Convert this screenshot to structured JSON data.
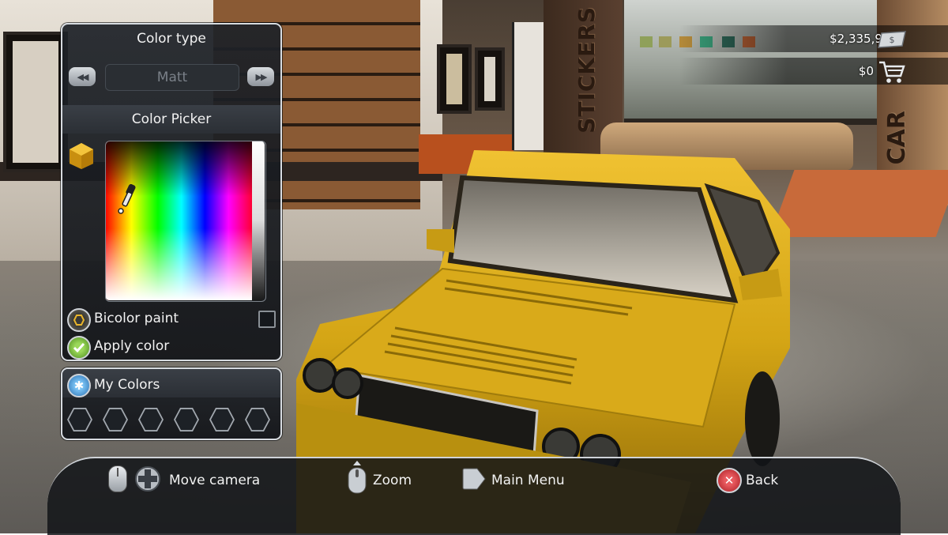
{
  "color_panel": {
    "title": "Color type",
    "selected_type": "Matt",
    "picker_title": "Color Picker",
    "bicolor_label": "Bicolor paint",
    "bicolor_checked": false,
    "apply_label": "Apply color"
  },
  "my_colors": {
    "title": "My Colors",
    "slots": [
      "empty",
      "empty",
      "empty",
      "empty",
      "empty",
      "empty"
    ]
  },
  "wallet": {
    "balance": "$2,335,921",
    "cart_total": "$0",
    "balance_icon": "cash-icon",
    "cart_icon": "shopping-cart-icon"
  },
  "footer": {
    "move_camera": "Move camera",
    "zoom": "Zoom",
    "main_menu": "Main Menu",
    "back": "Back"
  },
  "scene": {
    "sign_stickers": "STICKERS",
    "sign_car": "CAR"
  },
  "colors": {
    "car_paint": "#d4a515",
    "accent_yellow": "#e9b52c",
    "apply_green": "#7cc23c",
    "back_red": "#d8343a",
    "mycolors_blue": "#4aa3e6",
    "panel_border": "#d7dbe0"
  }
}
